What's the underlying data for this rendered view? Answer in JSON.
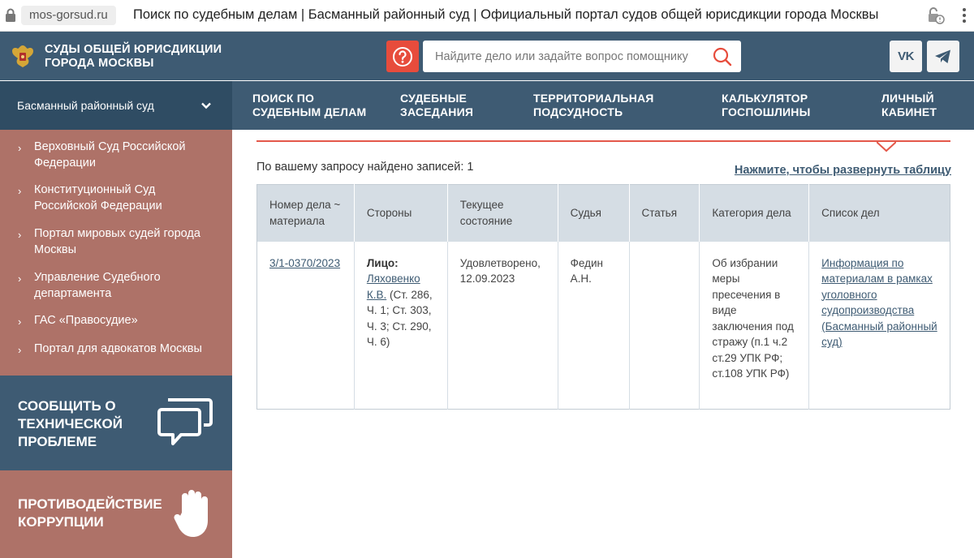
{
  "browser": {
    "url": "mos-gorsud.ru",
    "title": "Поиск по судебным делам | Басманный районный суд | Официальный портал судов общей юрисдикции города Москвы"
  },
  "header": {
    "site_name_line1": "Суды общей юрисдикции",
    "site_name_line2": "города Москвы",
    "help_icon": "question-circle-icon",
    "search_placeholder": "Найдите дело или задайте вопрос помощнику",
    "vk_label": "VK",
    "accent_color": "#e74c3c",
    "brand_color": "#3e5b73"
  },
  "nav": {
    "court": "Басманный районный суд",
    "items": [
      {
        "line1": "Поиск по",
        "line2": "судебным делам"
      },
      {
        "line1": "Судебные",
        "line2": "заседания"
      },
      {
        "line1": "Территориальная",
        "line2": "подсудность"
      },
      {
        "line1": "Калькулятор",
        "line2": "госпошлины"
      },
      {
        "line1": "Личный",
        "line2": "кабинет"
      }
    ]
  },
  "sidebar": {
    "links": [
      {
        "line1": "Верховный Суд Российской",
        "line2": "Федерации"
      },
      {
        "line1": "Конституционный Суд",
        "line2": "Российской Федерации"
      },
      {
        "line1": "Портал мировых судей города",
        "line2": "Москвы"
      },
      {
        "line1": "Управление Судебного",
        "line2": "департамента"
      },
      {
        "line1": "ГАС «Правосудие»",
        "line2": ""
      },
      {
        "line1": "Портал для адвокатов Москвы",
        "line2": ""
      }
    ],
    "tech_line1": "Сообщить о",
    "tech_line2": "технической",
    "tech_line3": "проблеме",
    "anti_line1": "Противодействие",
    "anti_line2": "коррупции",
    "sidebar_color": "#ae7268"
  },
  "main": {
    "result_count": "По вашему запросу найдено записей: 1",
    "expand_link": "Нажмите, чтобы развернуть таблицу",
    "columns": [
      "Номер дела ~ материала",
      "Стороны",
      "Текущее состояние",
      "Судья",
      "Статья",
      "Категория дела",
      "Список дел"
    ],
    "row": {
      "case_number": "3/1-0370/2023",
      "party_label": "Лицо:",
      "party_name": "Ляховенко К.В.",
      "party_articles": " (Ст. 286, Ч. 1; Ст. 303, Ч. 3; Ст. 290, Ч. 6)",
      "status": "Удовлетворено, 12.09.2023",
      "judge": "Федин А.Н.",
      "article": "",
      "category": "Об избрании меры пресечения в виде заключения под стражу (п.1 ч.2 ст.29 УПК РФ; ст.108 УПК РФ)",
      "case_list": "Информация по материалам в рамках уголовного судопроизводства (Басманный районный суд)"
    }
  }
}
